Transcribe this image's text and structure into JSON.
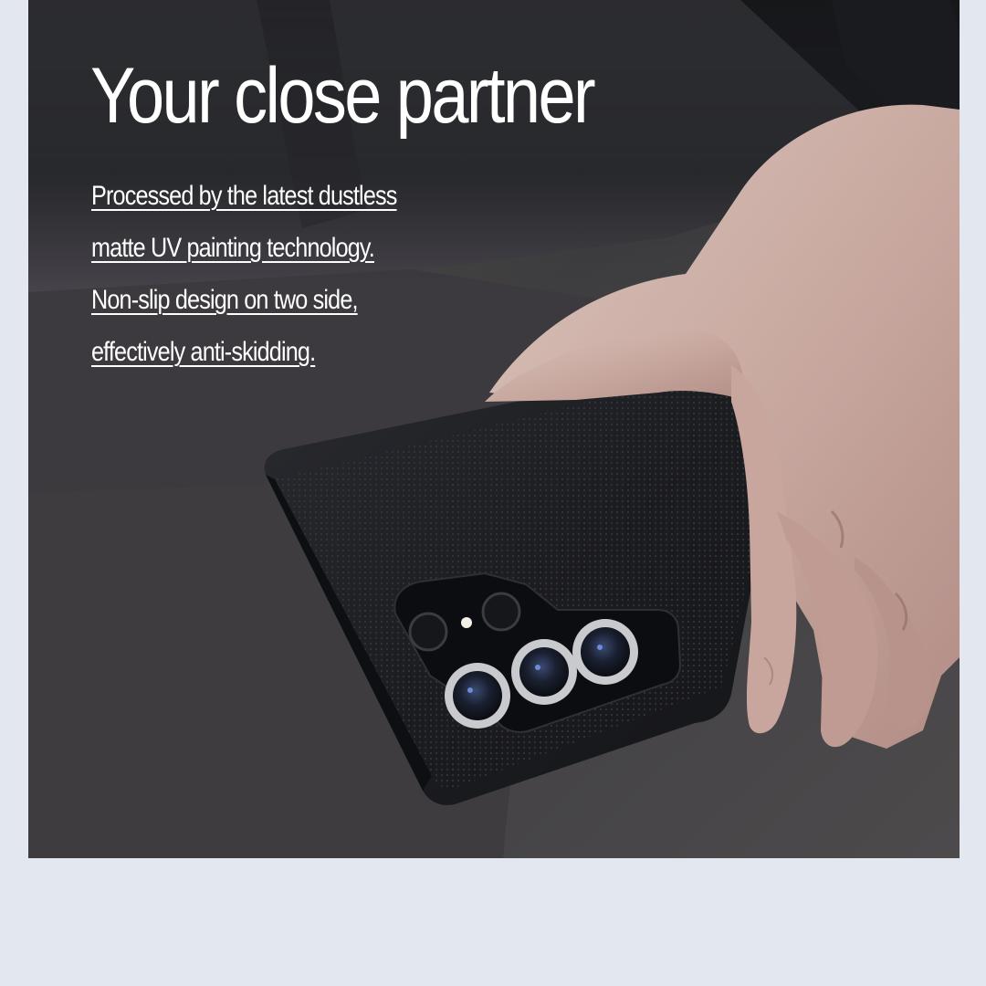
{
  "headline": "Your close partner",
  "features": {
    "line1": "Processed by the latest dustless",
    "line2": "matte UV painting technology.",
    "line3": "Non-slip design on two side,",
    "line4": "effectively anti-skidding."
  },
  "colors": {
    "page_background": "#e3e7ef",
    "text": "#ffffff",
    "case": "#1c1d21"
  }
}
